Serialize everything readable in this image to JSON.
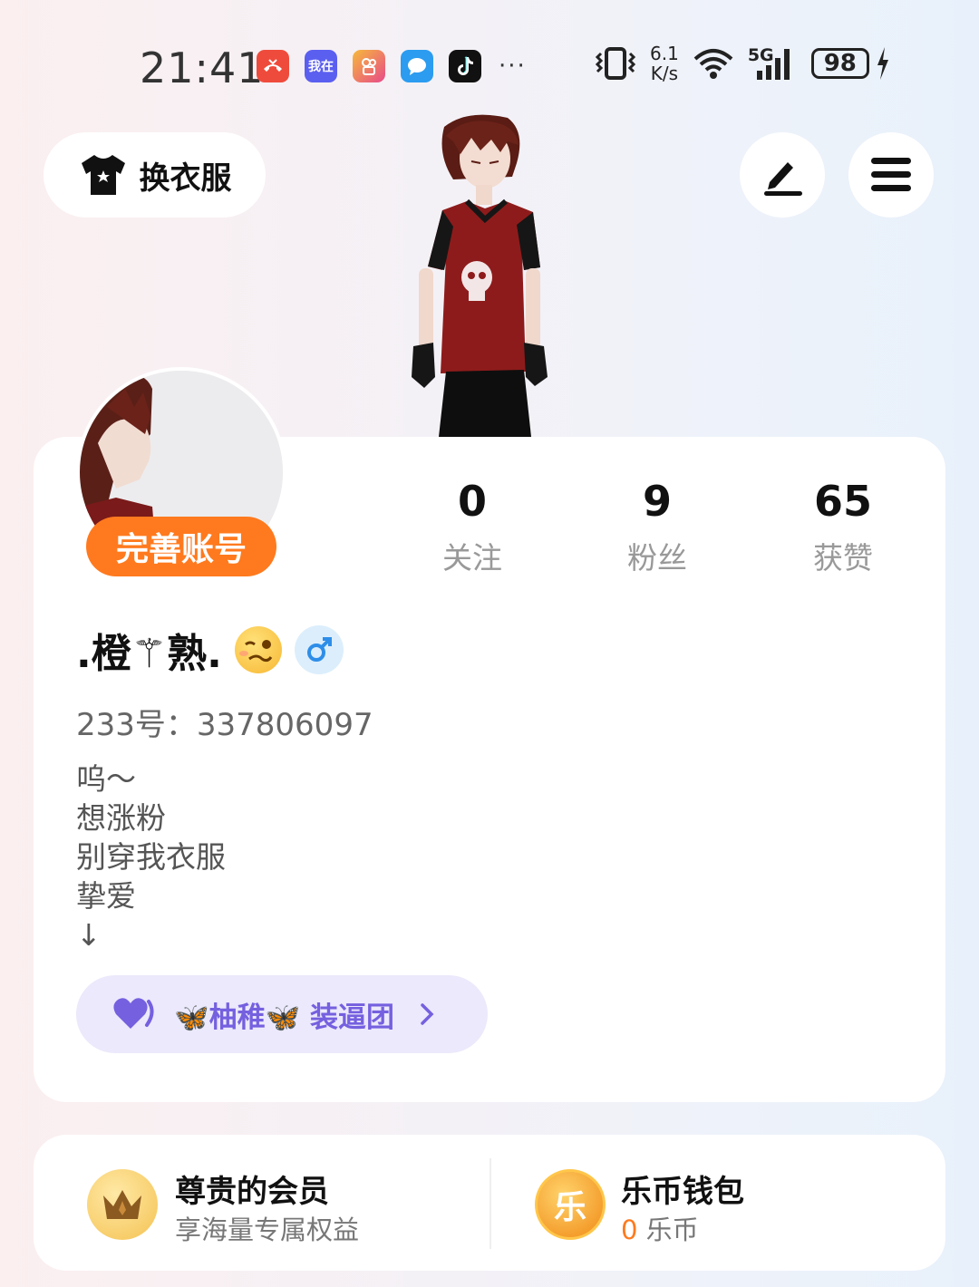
{
  "status_bar": {
    "time": "21:41",
    "notification_apps": [
      {
        "name": "missed-call-icon",
        "color": "#ef4b3c",
        "label": ""
      },
      {
        "name": "wozai-app-icon",
        "color": "#5b5ff0",
        "label": "我在"
      },
      {
        "name": "kuaishou-app-icon",
        "color": "#f2a13a",
        "label": ""
      },
      {
        "name": "messages-app-icon",
        "color": "#2b9cf0",
        "label": ""
      },
      {
        "name": "tiktok-app-icon",
        "color": "#111111",
        "label": ""
      }
    ],
    "more": "···",
    "net_speed_value": "6.1",
    "net_speed_unit": "K/s",
    "signal_label": "5G",
    "battery": "98"
  },
  "header": {
    "outfit_button": "换衣服"
  },
  "profile": {
    "complete_account": "完善账号",
    "stats": [
      {
        "value": "0",
        "label": "关注"
      },
      {
        "value": "9",
        "label": "粉丝"
      },
      {
        "value": "65",
        "label": "获赞"
      }
    ],
    "nickname": ".橙⚚熟.",
    "gender": "♂",
    "uid": "233号：337806097",
    "bio": [
      "呜～",
      "想涨粉",
      "别穿我衣服",
      "挚爱",
      "↓"
    ],
    "club": "🦋柚稚🦋 装逼团"
  },
  "bottom": {
    "vip_title": "尊贵的会员",
    "vip_sub": "享海量专属权益",
    "wallet_title": "乐币钱包",
    "wallet_amount": "0",
    "wallet_unit": "乐币",
    "wallet_icon_char": "乐"
  },
  "colors": {
    "accent_orange": "#ff7a1e",
    "club_purple": "#7560df"
  }
}
